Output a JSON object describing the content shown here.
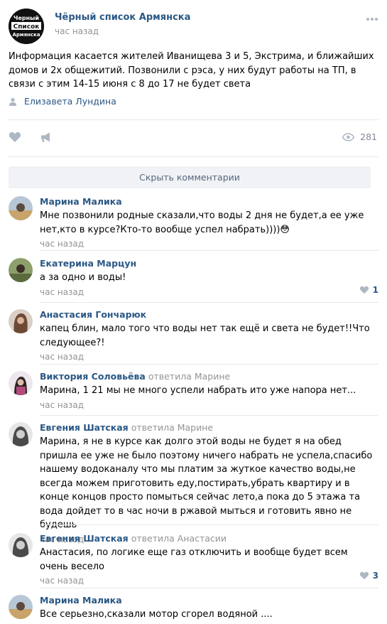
{
  "post": {
    "group_name": "Чёрный список Армянска",
    "group_logo_text": [
      "Черный",
      "Список",
      "Армянска"
    ],
    "time": "час назад",
    "text": "Информация касается жителей Иванищева 3 и 5, Экстрима, и ближайших домов и 2х общежитий. Позвонили с рэса, у них будут работы на ТП, в связи с этим 14-15 июня с 8 до 17 не будет света",
    "author": "Елизавета Лундина",
    "views": "281",
    "hide_comments_label": "Скрыть комментарии"
  },
  "comments": [
    {
      "name": "Марина Малика",
      "replied": "",
      "text": "Мне позвонили родные сказали,что воды 2 дня не будет,а ее уже нет,кто в курсе?Кто-то вообще успел набрать))))😳",
      "time": "час назад",
      "likes": "",
      "avatar_color": "#8a9bb0"
    },
    {
      "name": "Екатерина Марцун",
      "replied": "",
      "text": "а за одно и воды!",
      "time": "час назад",
      "likes": "1",
      "avatar_color": "#6d7a5a"
    },
    {
      "name": "Анастасия Гончарюк",
      "replied": "",
      "text": "капец блин, мало того что воды нет так ещё и света не будет!!Что следующее?!",
      "time": "час назад",
      "likes": "",
      "avatar_color": "#7a5a4e"
    },
    {
      "name": "Виктория Соловьёва",
      "replied": "ответила Марине",
      "text": "Марина, 1 21 мы не много успели набрать ито уже напора нет...",
      "time": "час назад",
      "likes": "",
      "avatar_color": "#c49aa8"
    },
    {
      "name": "Евгения Шатская",
      "replied": "ответила Марине",
      "text": "Марина, я не в курсе как долго этой воды не будет я на обед пришла ее уже не было поэтому ничего набрать не успела,спасибо нашему водоканалу что мы платим за жуткое качество воды,не всегда можем приготовить еду,постирать,убрать квартиру и в конце концов просто помыться сейчас лето,а пока до 5 этажа та вода дойдет то в час ночи в ржавой мыться и готовить явно не будешь",
      "time": "час назад",
      "likes": "",
      "avatar_color": "#9a9a9a"
    },
    {
      "name": "Евгения Шатская",
      "replied": "ответила Анастасии",
      "text": "Анастасия, по логике еще газ отключить и вообще будет всем очень весело",
      "time": "час назад",
      "likes": "3",
      "avatar_color": "#9a9a9a"
    },
    {
      "name": "Марина Малика",
      "replied": "",
      "text": "Все серьезно,сказали мотор сгорел водяной ....",
      "time": "",
      "likes": "",
      "avatar_color": "#8a9bb0"
    }
  ]
}
